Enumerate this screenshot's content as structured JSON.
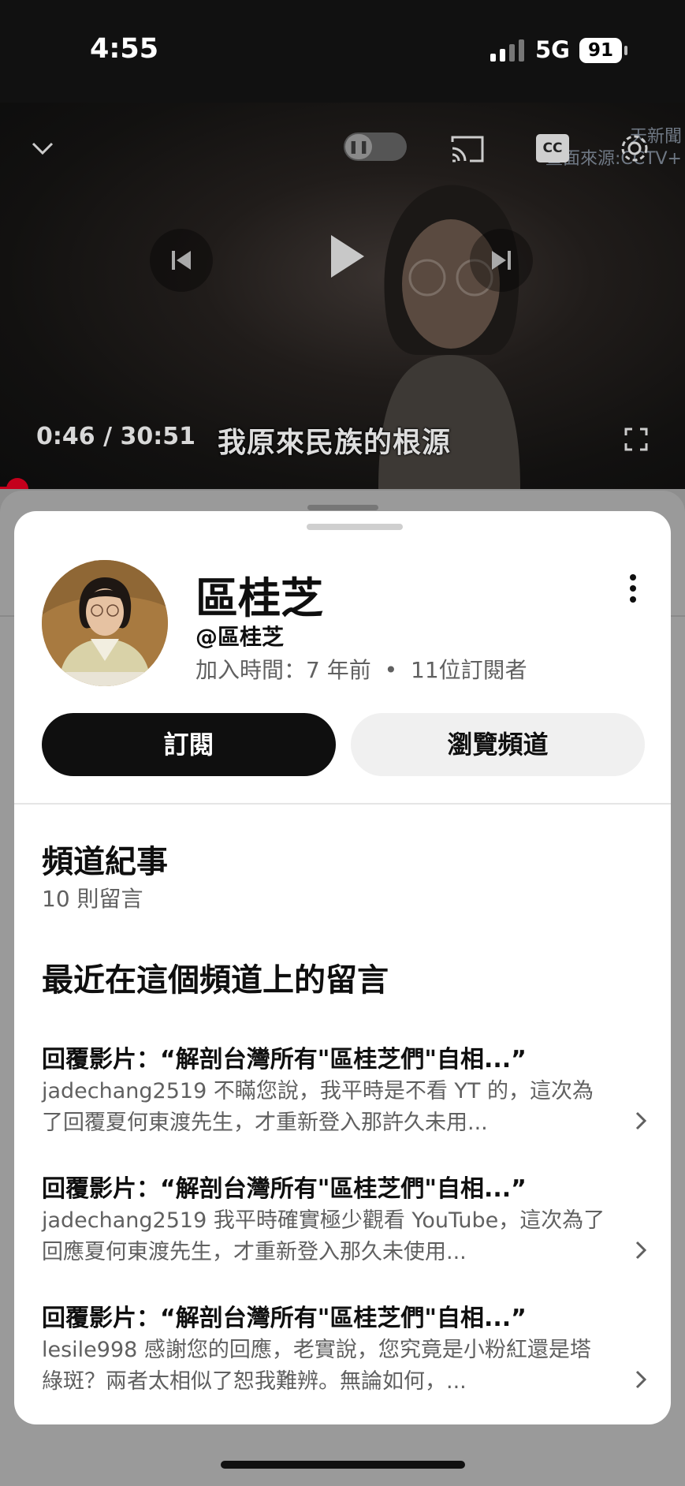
{
  "status_bar": {
    "time": "4:55",
    "network": "5G",
    "battery": "91"
  },
  "player": {
    "timecode": "0:46 / 30:51",
    "subtitle": "我原來民族的根源",
    "watermark_line1": "天新聞",
    "watermark_line2": "畫面來源:CCTV+",
    "cc_label": "CC",
    "progress_fraction": 0.025,
    "accent_color": "#c4001c",
    "icons": [
      "chevron-down-icon",
      "autoplay-toggle",
      "cast-icon",
      "cc-icon",
      "gear-icon",
      "previous-icon",
      "play-icon",
      "next-icon",
      "fullscreen-icon"
    ]
  },
  "channel": {
    "name": "區桂芝",
    "handle": "@區桂芝",
    "joined": "加入時間：7 年前",
    "separator": "•",
    "subscribers": "11位訂閱者",
    "subscribe_label": "訂閱",
    "browse_label": "瀏覽頻道"
  },
  "history": {
    "title": "頻道紀事",
    "count": "10 則留言",
    "recent_title": "最近在這個頻道上的留言",
    "comments": [
      {
        "title": "回覆影片：“解剖台灣所有\"區桂芝們\"自相...”",
        "body": "jadechang2519 不瞞您說，我平時是不看 YT 的，這次為了回覆夏何東渡先生，才重新登入那許久未用..."
      },
      {
        "title": "回覆影片：“解剖台灣所有\"區桂芝們\"自相...”",
        "body": "jadechang2519 我平時確實極少觀看 YouTube，這次為了回應夏何東渡先生，才重新登入那久未使用..."
      },
      {
        "title": "回覆影片：“解剖台灣所有\"區桂芝們\"自相...”",
        "body": "lesile998 感謝您的回應，老實說，您究竟是小粉紅還是塔綠斑？兩者太相似了恕我難辨。無論如何，..."
      }
    ]
  }
}
